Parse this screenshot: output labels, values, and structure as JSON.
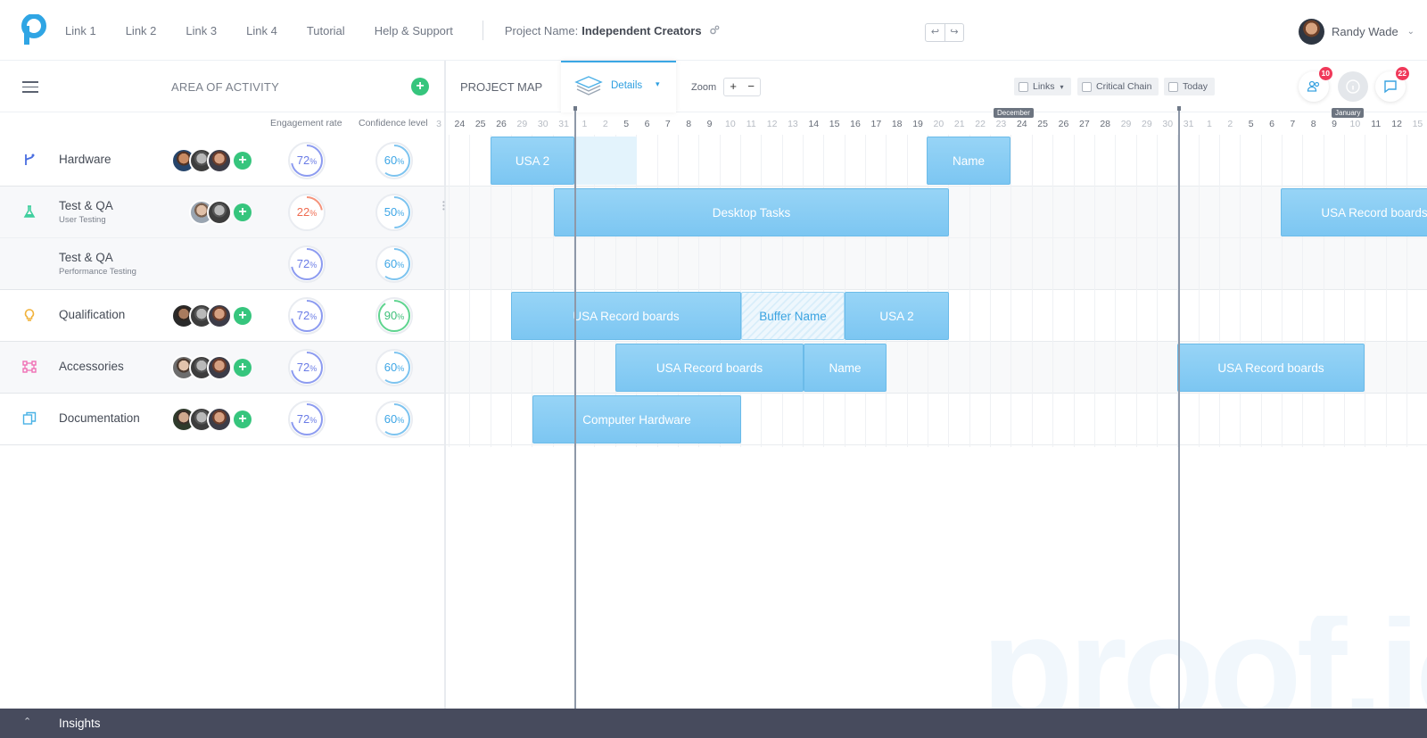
{
  "nav": {
    "links": [
      "Link 1",
      "Link 2",
      "Link 3",
      "Link 4",
      "Tutorial",
      "Help & Support"
    ],
    "project_label": "Project Name:",
    "project_name": "Independent Creators",
    "undo": "↩",
    "redo": "↪"
  },
  "user": {
    "name": "Randy Wade",
    "chevron": "⌄"
  },
  "left_panel": {
    "title": "AREA OF ACTIVITY",
    "add": "+",
    "col_engagement": "Engagement rate",
    "col_confidence": "Confidence level"
  },
  "rows": [
    {
      "name": "Hardware",
      "sub": "",
      "icon": "branch-icon",
      "engagement": "72",
      "confidence": "60",
      "avatars": 3
    },
    {
      "name": "Test & QA",
      "sub": "User Testing",
      "icon": "flask-icon",
      "engagement": "22",
      "confidence": "50",
      "avatars": 2
    },
    {
      "name": "Test & QA",
      "sub": "Performance Testing",
      "icon": "",
      "engagement": "72",
      "confidence": "60",
      "avatars": 0
    },
    {
      "name": "Qualification",
      "sub": "",
      "icon": "lightbulb-icon",
      "engagement": "72",
      "confidence": "90",
      "avatars": 3
    },
    {
      "name": "Accessories",
      "sub": "",
      "icon": "nodes-icon",
      "engagement": "72",
      "confidence": "60",
      "avatars": 3
    },
    {
      "name": "Documentation",
      "sub": "",
      "icon": "docs-icon",
      "engagement": "72",
      "confidence": "60",
      "avatars": 3
    }
  ],
  "percent_sign": "%",
  "map": {
    "title": "PROJECT MAP",
    "details_tab": "Details",
    "zoom_label": "Zoom",
    "zoom_in": "+",
    "zoom_out": "−",
    "filter_links": "Links",
    "filter_critical": "Critical Chain",
    "filter_today": "Today",
    "team_badge": "10",
    "chat_badge": "22"
  },
  "timeline": {
    "days": [
      "3",
      "24",
      "25",
      "26",
      "29",
      "30",
      "31",
      "1",
      "2",
      "5",
      "6",
      "7",
      "8",
      "9",
      "10",
      "11",
      "12",
      "13",
      "14",
      "15",
      "16",
      "17",
      "18",
      "19",
      "20",
      "21",
      "22",
      "23",
      "24",
      "25",
      "26",
      "27",
      "28",
      "29",
      "29",
      "30",
      "31",
      "1",
      "2",
      "5",
      "6",
      "7",
      "8",
      "9",
      "10",
      "11",
      "12",
      "15"
    ],
    "weekend_idx": [
      0,
      4,
      5,
      6,
      7,
      8,
      14,
      15,
      16,
      17,
      24,
      25,
      26,
      27,
      33,
      34,
      35,
      36,
      37,
      38,
      44,
      47
    ],
    "months": [
      "December",
      "January"
    ]
  },
  "tasks": [
    {
      "label": "USA 2",
      "row": 0,
      "style": "normal"
    },
    {
      "label": "",
      "row": 0,
      "style": "light"
    },
    {
      "label": "Name",
      "row": 0,
      "style": "normal"
    },
    {
      "label": "Desktop Tasks",
      "row": 1,
      "style": "normal"
    },
    {
      "label": "USA Record boards",
      "row": 1,
      "style": "normal"
    },
    {
      "label": "USA Record boards",
      "row": 3,
      "style": "normal"
    },
    {
      "label": "Buffer Name",
      "row": 3,
      "style": "buffer"
    },
    {
      "label": "USA 2",
      "row": 3,
      "style": "normal"
    },
    {
      "label": "USA Record boards",
      "row": 4,
      "style": "normal"
    },
    {
      "label": "Name",
      "row": 4,
      "style": "normal"
    },
    {
      "label": "USA Record boards",
      "row": 4,
      "style": "normal"
    },
    {
      "label": "Computer Hardware",
      "row": 5,
      "style": "normal"
    }
  ],
  "watermark": "proof.io",
  "bottom": {
    "label": "Insights",
    "toggle": "⌃"
  },
  "colors": {
    "accent": "#2e9fe0",
    "green": "#36c57d",
    "red": "#f0395a",
    "bar": "#8ccff5",
    "footer": "#474b5d"
  }
}
